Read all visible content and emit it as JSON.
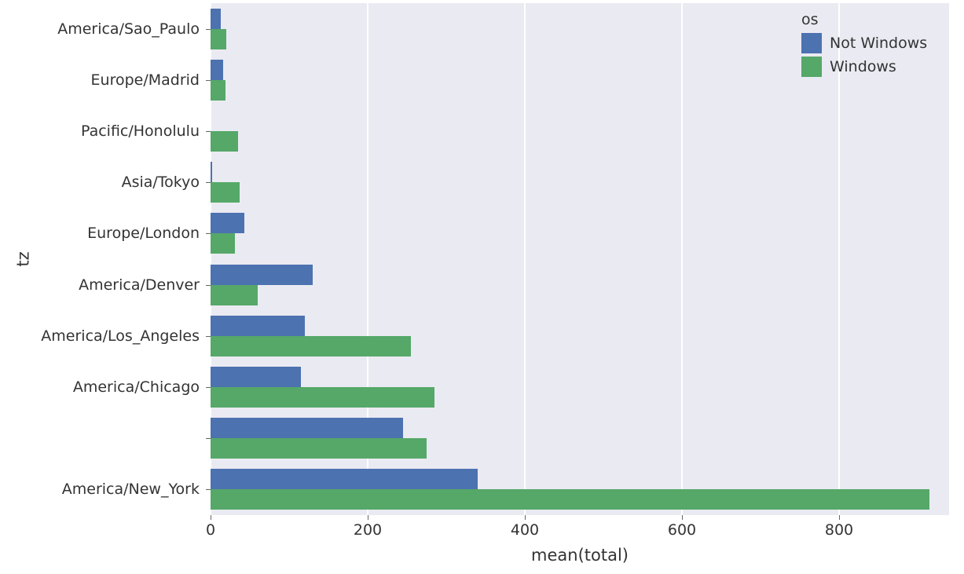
{
  "chart_data": {
    "type": "bar",
    "orientation": "horizontal",
    "xlabel": "mean(total)",
    "ylabel": "tz",
    "xlim": [
      0,
      940
    ],
    "x_ticks": [
      0,
      200,
      400,
      600,
      800
    ],
    "categories": [
      "America/Sao_Paulo",
      "Europe/Madrid",
      "Pacific/Honolulu",
      "Asia/Tokyo",
      "Europe/London",
      "America/Denver",
      "America/Los_Angeles",
      "America/Chicago",
      "",
      "America/New_York"
    ],
    "legend_title": "os",
    "series": [
      {
        "name": "Not Windows",
        "color": "#4c72b0",
        "values": [
          13,
          16,
          0,
          2,
          43,
          130,
          120,
          115,
          245,
          340
        ]
      },
      {
        "name": "Windows",
        "color": "#55a868",
        "values": [
          20,
          19,
          35,
          37,
          31,
          60,
          255,
          285,
          275,
          915
        ]
      }
    ],
    "colors": {
      "not_windows": "#4c72b0",
      "windows": "#55a868"
    }
  }
}
